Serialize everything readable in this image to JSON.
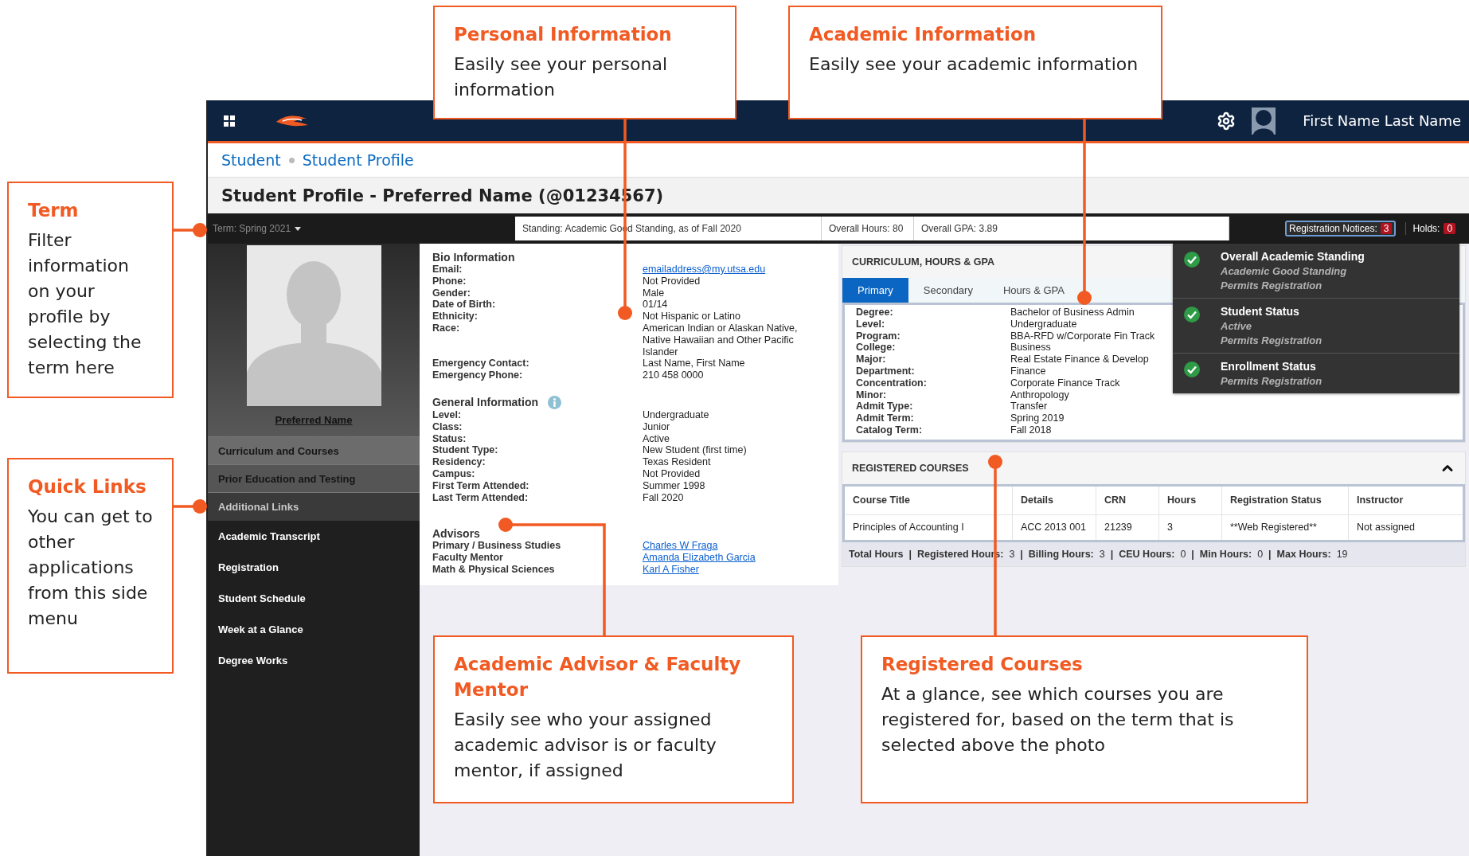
{
  "topbar": {
    "user_name": "First Name Last Name"
  },
  "breadcrumb": [
    "Student",
    "Student Profile"
  ],
  "page_title": "Student Profile - Preferred Name (@01234567)",
  "term_bar": {
    "term": "Term: Spring 2021",
    "summary": [
      "Standing: Academic Good Standing, as of Fall 2020",
      "Overall Hours: 80",
      "Overall GPA: 3.89"
    ],
    "registration_notices": {
      "label": "Registration Notices:",
      "count": "3"
    },
    "holds": {
      "label": "Holds:",
      "count": "0"
    }
  },
  "sidebar": {
    "photo_caption": "Preferred Name",
    "items": [
      {
        "label": "Curriculum and Courses",
        "kind": "section"
      },
      {
        "label": "Prior Education and Testing",
        "kind": "section"
      },
      {
        "label": "Additional Links",
        "kind": "heading"
      },
      {
        "label": "Academic Transcript",
        "kind": "link"
      },
      {
        "label": "Registration",
        "kind": "link"
      },
      {
        "label": "Student Schedule",
        "kind": "link"
      },
      {
        "label": "Week at a Glance",
        "kind": "link"
      },
      {
        "label": "Degree Works",
        "kind": "link"
      }
    ]
  },
  "bio": {
    "title": "Bio Information",
    "rows": [
      {
        "label": "Email:",
        "value": "emailaddress@my.utsa.edu",
        "kind": "link"
      },
      {
        "label": "Phone:",
        "value": "Not Provided",
        "kind": "text"
      },
      {
        "label": "Gender:",
        "value": "Male",
        "kind": "text"
      },
      {
        "label": "Date of Birth:",
        "value": "01/14",
        "kind": "text"
      },
      {
        "label": "Ethnicity:",
        "value": "Not Hispanic or Latino",
        "kind": "text"
      },
      {
        "label": "Race:",
        "value": "American Indian or Alaskan Native, Native Hawaiian and Other Pacific Islander",
        "kind": "text"
      },
      {
        "label": "Emergency Contact:",
        "value": "Last Name, First Name",
        "kind": "text"
      },
      {
        "label": "Emergency Phone:",
        "value": "210 458 0000",
        "kind": "text"
      }
    ]
  },
  "general": {
    "title": "General Information",
    "rows": [
      {
        "label": "Level:",
        "value": "Undergraduate"
      },
      {
        "label": "Class:",
        "value": "Junior"
      },
      {
        "label": "Status:",
        "value": "Active"
      },
      {
        "label": "Student Type:",
        "value": "New Student (first time)"
      },
      {
        "label": "Residency:",
        "value": "Texas Resident"
      },
      {
        "label": "Campus:",
        "value": "Not Provided"
      },
      {
        "label": "First Term Attended:",
        "value": "Summer 1998"
      },
      {
        "label": "Last Term Attended:",
        "value": "Fall 2020"
      }
    ]
  },
  "advisors": {
    "title": "Advisors",
    "rows": [
      {
        "label": "Primary / Business Studies",
        "value": "Charles W Fraga",
        "kind": "link"
      },
      {
        "label": "Faculty Mentor",
        "value": "Amanda Elizabeth Garcia",
        "kind": "link"
      },
      {
        "label": "Math & Physical Sciences",
        "value": "Karl A Fisher",
        "kind": "link"
      }
    ]
  },
  "curriculum": {
    "title": "CURRICULUM, HOURS & GPA",
    "tabs": [
      {
        "label": "Primary",
        "selected": true
      },
      {
        "label": "Secondary",
        "selected": false
      },
      {
        "label": "Hours & GPA",
        "selected": false
      }
    ],
    "rows": [
      {
        "label": "Degree:",
        "value": "Bachelor of Business Admin"
      },
      {
        "label": "Level:",
        "value": "Undergraduate"
      },
      {
        "label": "Program:",
        "value": "BBA-RFD w/Corporate Fin Track"
      },
      {
        "label": "College:",
        "value": "Business"
      },
      {
        "label": "Major:",
        "value": "Real Estate Finance & Develop"
      },
      {
        "label": "Department:",
        "value": "Finance"
      },
      {
        "label": "Concentration:",
        "value": "Corporate Finance Track"
      },
      {
        "label": "Minor:",
        "value": "Anthropology"
      },
      {
        "label": "Admit Type:",
        "value": "Transfer"
      },
      {
        "label": "Admit Term:",
        "value": "Spring 2019"
      },
      {
        "label": "Catalog Term:",
        "value": "Fall 2018"
      }
    ]
  },
  "status_panel": [
    {
      "title": "Overall Academic Standing",
      "lines": [
        "Academic Good Standing",
        "Permits Registration"
      ]
    },
    {
      "title": "Student Status",
      "lines": [
        "Active",
        "Permits Registration"
      ]
    },
    {
      "title": "Enrollment Status",
      "lines": [
        "Permits Registration"
      ]
    }
  ],
  "registered_courses": {
    "title": "REGISTERED COURSES",
    "expanded": true,
    "columns": [
      "Course Title",
      "Details",
      "CRN",
      "Hours",
      "Registration Status",
      "Instructor"
    ],
    "rows": [
      [
        "Principles of Accounting I",
        "ACC 2013 001",
        "21239",
        "3",
        "**Web Registered**",
        "Not assigned"
      ]
    ],
    "separator": "|",
    "totals": [
      {
        "label": "Total Hours"
      },
      {
        "label": "Registered Hours:",
        "value": "3"
      },
      {
        "label": "Billing Hours:",
        "value": "3"
      },
      {
        "label": "CEU Hours:",
        "value": "0"
      },
      {
        "label": "Min Hours:",
        "value": "0"
      },
      {
        "label": "Max Hours:",
        "value": "19"
      }
    ]
  },
  "callouts": [
    {
      "title": "Personal Information",
      "text": "Easily see your personal information"
    },
    {
      "title": "Academic Information",
      "text": "Easily see your academic information"
    },
    {
      "title": "Term",
      "text": "Filter information on your profile by selecting the term here"
    },
    {
      "title": "Quick Links",
      "text": "You can get to other applications from this side menu"
    },
    {
      "title": "Academic Advisor & Faculty Mentor",
      "text": "Easily see who your assigned academic advisor is or faculty mentor, if assigned"
    },
    {
      "title": "Registered Courses",
      "text": "At a glance, see which courses you are registered for, based on the term that is selected above the photo"
    }
  ]
}
